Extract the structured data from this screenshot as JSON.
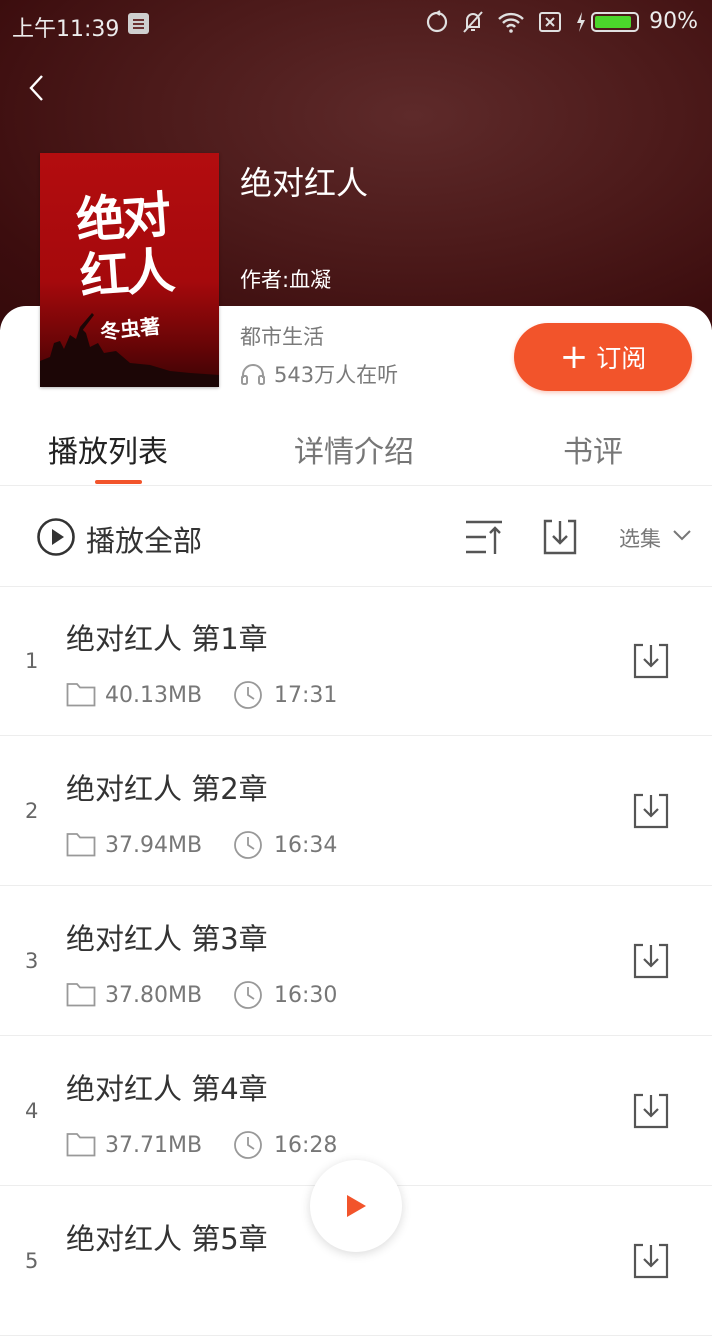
{
  "status_bar": {
    "time": "上午11:39",
    "battery": "90%",
    "battery_level": 0.9,
    "icons": [
      "notes-icon",
      "sync-icon",
      "mute-bell-icon",
      "wifi-icon",
      "sim-off-icon",
      "charging-icon",
      "battery-icon"
    ]
  },
  "header": {
    "back_icon": "chevron-left-icon"
  },
  "book": {
    "cover_title": "绝对红人",
    "cover_author": "冬虫著",
    "title": "绝对红人",
    "author": "作者:血凝",
    "category": "都市生活",
    "listeners": "543万人在听"
  },
  "subscribe": {
    "plus": "+",
    "label": "订阅"
  },
  "tabs": [
    {
      "label": "播放列表",
      "active": true
    },
    {
      "label": "详情介绍",
      "active": false
    },
    {
      "label": "书评",
      "active": false
    }
  ],
  "toolbar": {
    "play_all": "播放全部",
    "select": "选集"
  },
  "chapters": [
    {
      "num": "1",
      "title": "绝对红人  第1章",
      "size": "40.13MB",
      "duration": "17:31"
    },
    {
      "num": "2",
      "title": "绝对红人  第2章",
      "size": "37.94MB",
      "duration": "16:34"
    },
    {
      "num": "3",
      "title": "绝对红人  第3章",
      "size": "37.80MB",
      "duration": "16:30"
    },
    {
      "num": "4",
      "title": "绝对红人  第4章",
      "size": "37.71MB",
      "duration": "16:28"
    },
    {
      "num": "5",
      "title": "绝对红人  第5章"
    }
  ],
  "colors": {
    "accent": "#f2542b",
    "header_bg": "#4c1a1a",
    "cover_red": "#b30d0f"
  }
}
